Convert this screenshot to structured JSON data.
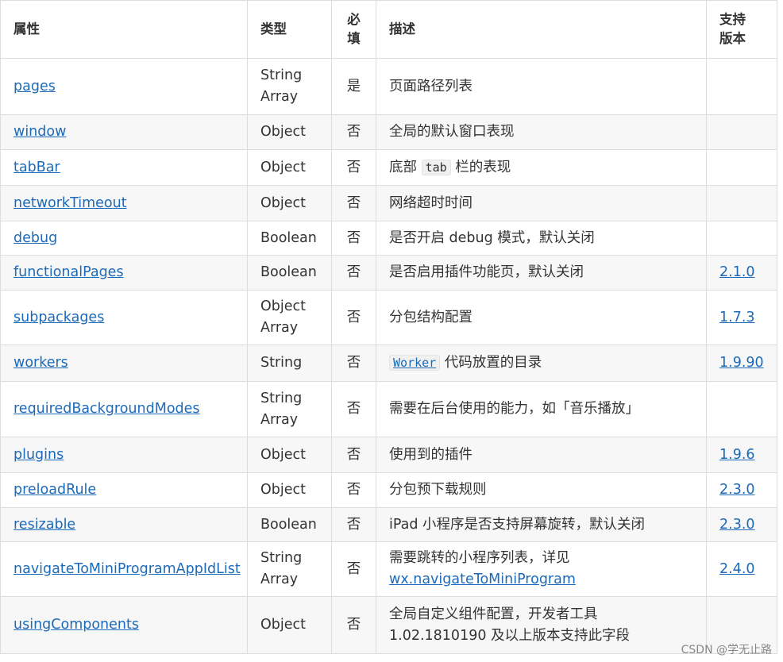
{
  "header": {
    "property": "属性",
    "type": "类型",
    "required": "必填",
    "description": "描述",
    "version": "支持版本"
  },
  "rows": [
    {
      "name": "pages",
      "type": [
        "String",
        "Array"
      ],
      "required": "是",
      "desc": [
        {
          "t": "页面路径列表"
        }
      ],
      "version": ""
    },
    {
      "name": "window",
      "type": [
        "Object"
      ],
      "required": "否",
      "desc": [
        {
          "t": "全局的默认窗口表现"
        }
      ],
      "version": ""
    },
    {
      "name": "tabBar",
      "type": [
        "Object"
      ],
      "required": "否",
      "desc": [
        {
          "t": "底部 "
        },
        {
          "code": "tab"
        },
        {
          "t": " 栏的表现"
        }
      ],
      "version": ""
    },
    {
      "name": "networkTimeout",
      "type": [
        "Object"
      ],
      "required": "否",
      "desc": [
        {
          "t": "网络超时时间"
        }
      ],
      "version": ""
    },
    {
      "name": "debug",
      "type": [
        "Boolean"
      ],
      "required": "否",
      "desc": [
        {
          "t": "是否开启 debug 模式，默认关闭"
        }
      ],
      "version": ""
    },
    {
      "name": "functionalPages",
      "type": [
        "Boolean"
      ],
      "required": "否",
      "desc": [
        {
          "t": "是否启用插件功能页，默认关闭"
        }
      ],
      "version": "2.1.0"
    },
    {
      "name": "subpackages",
      "type": [
        "Object",
        "Array"
      ],
      "required": "否",
      "desc": [
        {
          "t": "分包结构配置"
        }
      ],
      "version": "1.7.3"
    },
    {
      "name": "workers",
      "type": [
        "String"
      ],
      "required": "否",
      "desc": [
        {
          "codelink": "Worker"
        },
        {
          "t": " 代码放置的目录"
        }
      ],
      "version": "1.9.90"
    },
    {
      "name": "requiredBackgroundModes",
      "type": [
        "String",
        "Array"
      ],
      "required": "否",
      "desc": [
        {
          "t": "需要在后台使用的能力，如「音乐播放」"
        }
      ],
      "version": ""
    },
    {
      "name": "plugins",
      "type": [
        "Object"
      ],
      "required": "否",
      "desc": [
        {
          "t": "使用到的插件"
        }
      ],
      "version": "1.9.6"
    },
    {
      "name": "preloadRule",
      "type": [
        "Object"
      ],
      "required": "否",
      "desc": [
        {
          "t": "分包预下载规则"
        }
      ],
      "version": "2.3.0"
    },
    {
      "name": "resizable",
      "type": [
        "Boolean"
      ],
      "required": "否",
      "desc": [
        {
          "t": "iPad 小程序是否支持屏幕旋转，默认关闭"
        }
      ],
      "version": "2.3.0"
    },
    {
      "name": "navigateToMiniProgramAppIdList",
      "type": [
        "String",
        "Array"
      ],
      "required": "否",
      "desc": [
        {
          "t": "需要跳转的小程序列表，详见"
        },
        {
          "br": true
        },
        {
          "link": "wx.navigateToMiniProgram"
        }
      ],
      "version": "2.4.0"
    },
    {
      "name": "usingComponents",
      "type": [
        "Object"
      ],
      "required": "否",
      "desc": [
        {
          "t": "全局自定义组件配置，开发者工具"
        },
        {
          "br": true
        },
        {
          "t": "1.02.1810190 及以上版本支持此字段"
        }
      ],
      "version": ""
    }
  ],
  "watermark": "CSDN @学无止路"
}
